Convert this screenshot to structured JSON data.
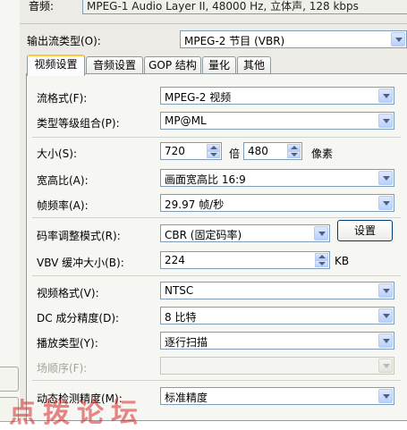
{
  "audio": {
    "label": "音频:",
    "value": "MPEG-1 Audio Layer II, 48000 Hz, 立体声, 128 kbps"
  },
  "output_stream_type": {
    "label": "输出流类型(O):",
    "value": "MPEG-2 节目 (VBR)"
  },
  "tabs": [
    {
      "label": "视频设置",
      "active": true
    },
    {
      "label": "音频设置",
      "active": false
    },
    {
      "label": "GOP 结构",
      "active": false
    },
    {
      "label": "量化",
      "active": false
    },
    {
      "label": "其他",
      "active": false
    }
  ],
  "video": {
    "stream_format": {
      "label": "流格式(F):",
      "value": "MPEG-2 视频"
    },
    "profile_level": {
      "label": "类型等级组合(P):",
      "value": "MP@ML"
    },
    "size": {
      "label": "大小(S):",
      "width": "720",
      "times": "倍",
      "height": "480",
      "unit": "像素"
    },
    "aspect": {
      "label": "宽高比(A):",
      "value": "画面宽高比 16:9"
    },
    "frame_rate": {
      "label": "帧频率(A):",
      "value": "29.97 帧/秒"
    },
    "bitrate_mode": {
      "label": "码率调整模式(R):",
      "value": "CBR (固定码率)",
      "settings_button": "设置"
    },
    "vbv": {
      "label": "VBV 缓冲大小(B):",
      "value": "224",
      "unit": "KB"
    },
    "video_format": {
      "label": "视频格式(V):",
      "value": "NTSC"
    },
    "dc_precision": {
      "label": "DC 成分精度(D):",
      "value": "8 比特"
    },
    "scan_type": {
      "label": "播放类型(Y):",
      "value": "逐行扫描"
    },
    "field_order": {
      "label": "场顺序(F):",
      "value": ""
    },
    "motion_precision": {
      "label": "动态检测精度(M):",
      "value": "标准精度"
    }
  },
  "watermark": "点拨论坛",
  "colors": {
    "tab_active_accent": "#ffc83c",
    "input_border": "#7f9db9",
    "watermark": "#d62828"
  }
}
